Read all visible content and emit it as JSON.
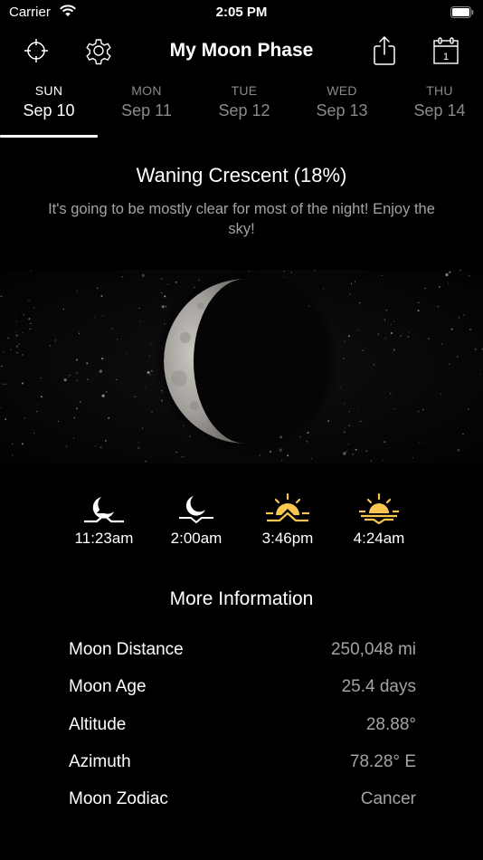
{
  "status_bar": {
    "carrier": "Carrier",
    "time": "2:05 PM",
    "wifi_icon": "wifi-icon",
    "battery_icon": "battery-full-icon"
  },
  "nav": {
    "title": "My Moon Phase",
    "left_buttons": [
      {
        "name": "location-button",
        "icon": "crosshair-icon"
      },
      {
        "name": "settings-button",
        "icon": "gear-icon"
      }
    ],
    "right_buttons": [
      {
        "name": "share-button",
        "icon": "share-icon"
      },
      {
        "name": "calendar-button",
        "icon": "calendar-icon",
        "badge": "1"
      }
    ]
  },
  "days": [
    {
      "dow": "SUN",
      "date": "Sep 10",
      "active": true
    },
    {
      "dow": "MON",
      "date": "Sep 11",
      "active": false
    },
    {
      "dow": "TUE",
      "date": "Sep 12",
      "active": false
    },
    {
      "dow": "WED",
      "date": "Sep 13",
      "active": false
    },
    {
      "dow": "THU",
      "date": "Sep 14",
      "active": false
    }
  ],
  "phase": {
    "title": "Waning Crescent (18%)",
    "illumination_percent": 18,
    "description": "It's going to be mostly clear for most of the night! Enjoy the sky!"
  },
  "events": [
    {
      "icon": "moonrise-icon",
      "time": "11:23am"
    },
    {
      "icon": "moonset-icon",
      "time": "2:00am"
    },
    {
      "icon": "sunrise-icon",
      "time": "3:46pm"
    },
    {
      "icon": "sunset-icon",
      "time": "4:24am"
    }
  ],
  "colors": {
    "background": "#000000",
    "text_primary": "#ffffff",
    "text_secondary": "#a3a3a3",
    "sun_accent": "#f9c74f"
  },
  "more_info": {
    "title": "More Information",
    "rows": [
      {
        "label": "Moon Distance",
        "value": "250,048 mi"
      },
      {
        "label": "Moon Age",
        "value": "25.4 days"
      },
      {
        "label": "Altitude",
        "value": "28.88°"
      },
      {
        "label": "Azimuth",
        "value": "78.28° E"
      },
      {
        "label": "Moon Zodiac",
        "value": "Cancer"
      }
    ]
  }
}
